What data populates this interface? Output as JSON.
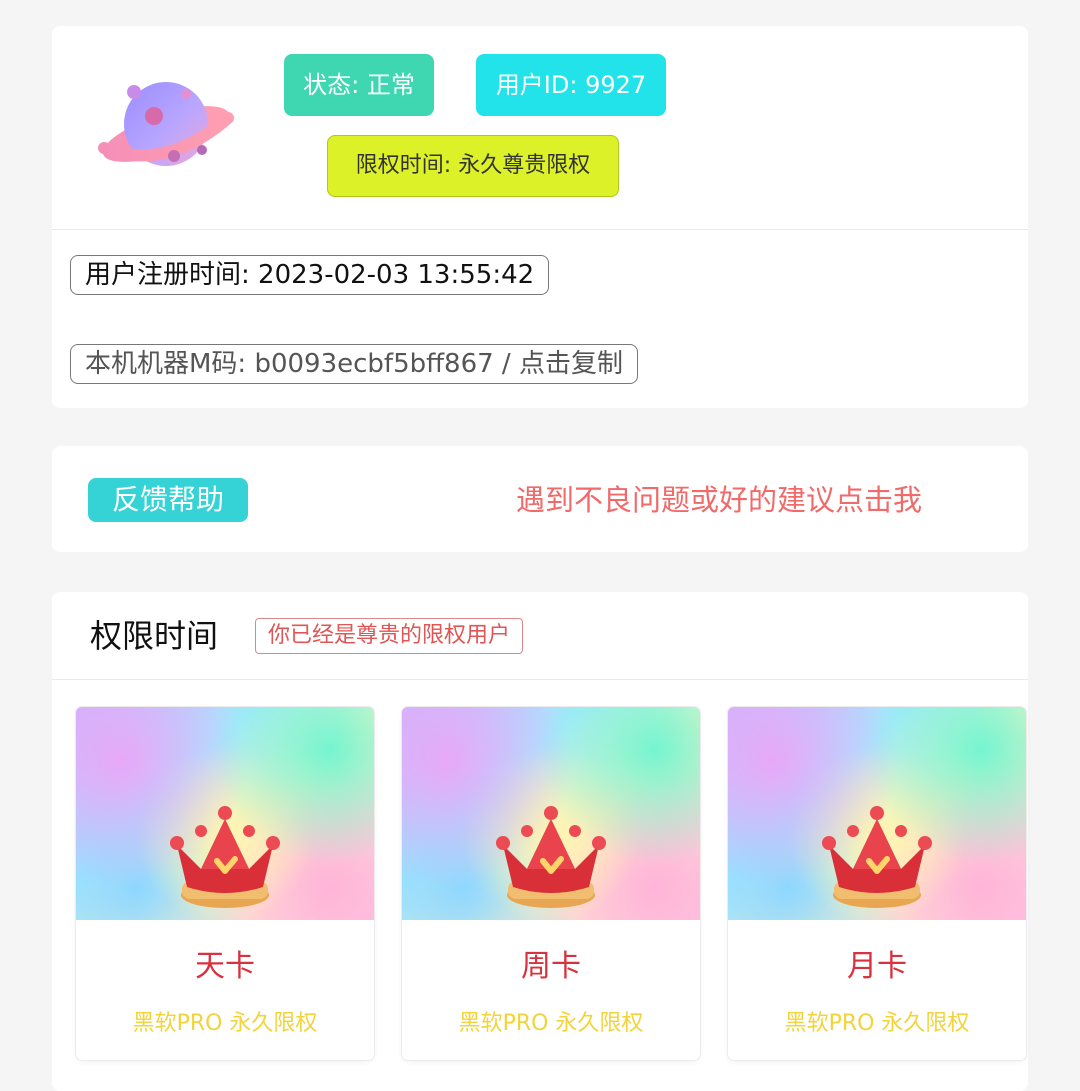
{
  "profile": {
    "avatar_icon": "planet-icon",
    "status_label": "状态: 正常",
    "user_id_label": "用户ID: 9927",
    "privilege_label": "限权时间: 永久尊贵限权",
    "registration_label": "用户注册时间: 2023-02-03 13:55:42",
    "machine_code_label": "本机机器M码: b0093ecbf5bff867 / 点击复制"
  },
  "feedback": {
    "badge_label": "反馈帮助",
    "link_text": "遇到不良问题或好的建议点击我",
    "link_color": "#f06a6a"
  },
  "privileges": {
    "title": "权限时间",
    "note": "你已经是尊贵的限权用户",
    "plans": [
      {
        "name": "天卡",
        "description": "黑软PRO 永久限权",
        "icon": "crown-icon"
      },
      {
        "name": "周卡",
        "description": "黑软PRO 永久限权",
        "icon": "crown-icon"
      },
      {
        "name": "月卡",
        "description": "黑软PRO 永久限权",
        "icon": "crown-icon"
      }
    ]
  },
  "colors": {
    "status": "#3fd7b1",
    "user_id": "#22e3ea",
    "privilege": "#dcf128",
    "feedback_badge": "#35d3d6",
    "plan_name": "#d8323f",
    "plan_desc": "#f2d43a"
  }
}
